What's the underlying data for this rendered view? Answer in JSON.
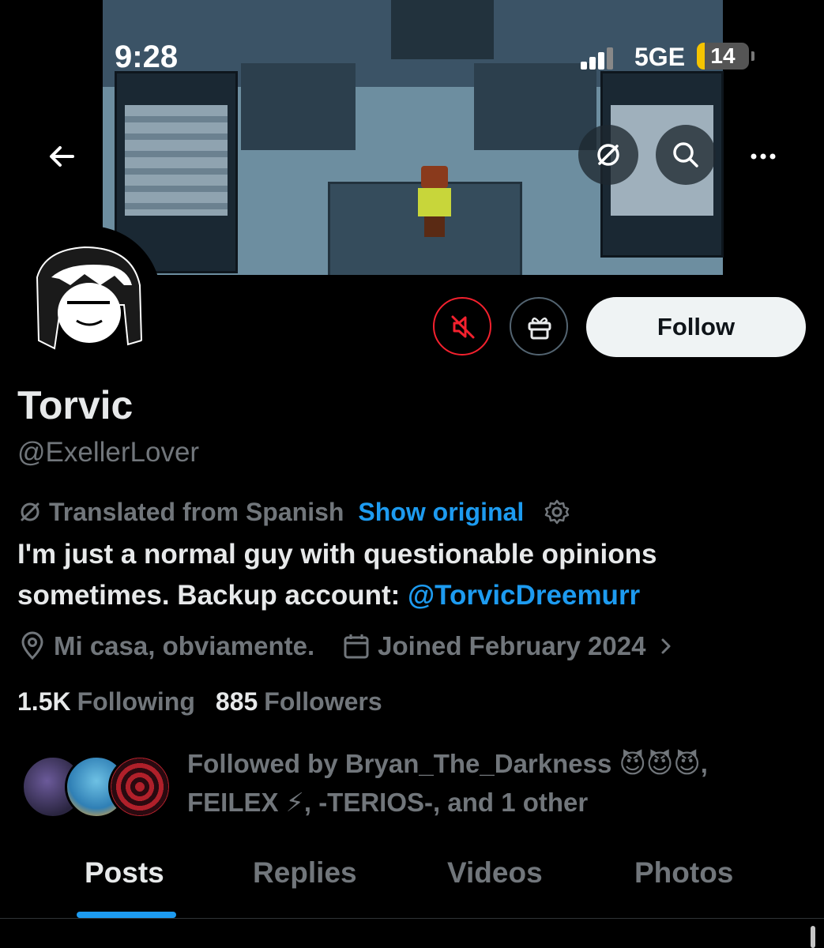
{
  "status_bar": {
    "time": "9:28",
    "network": "5GE",
    "battery": "14"
  },
  "profile": {
    "name": "Torvic",
    "handle": "@ExellerLover",
    "translated_label": "Translated from Spanish",
    "show_original": "Show original",
    "bio_text": "I'm just a normal guy with questionable opinions sometimes. Backup account: ",
    "bio_mention": "@TorvicDreemurr",
    "location": "Mi casa, obviamente.",
    "joined": "Joined February 2024",
    "following_count": "1.5K",
    "following_label": "Following",
    "followers_count": "885",
    "followers_label": "Followers",
    "followed_by": "Followed by Bryan_The_Darkness 😈😈😈, FEILEX ⚡, -TERIOS-, and 1 other"
  },
  "actions": {
    "follow_label": "Follow"
  },
  "tabs": [
    {
      "label": "Posts",
      "active": true
    },
    {
      "label": "Replies",
      "active": false
    },
    {
      "label": "Videos",
      "active": false
    },
    {
      "label": "Photos",
      "active": false
    }
  ],
  "colors": {
    "accent": "#1d9bf0",
    "muted": "#71767b",
    "text": "#e7e9ea",
    "danger": "#f4212e",
    "background": "#000000"
  },
  "icons": [
    "back-arrow-icon",
    "translate-icon",
    "search-icon",
    "more-icon",
    "muted-speaker-icon",
    "gift-icon",
    "location-pin-icon",
    "calendar-icon",
    "chevron-right-icon",
    "gear-icon",
    "signal-icon",
    "battery-icon"
  ]
}
